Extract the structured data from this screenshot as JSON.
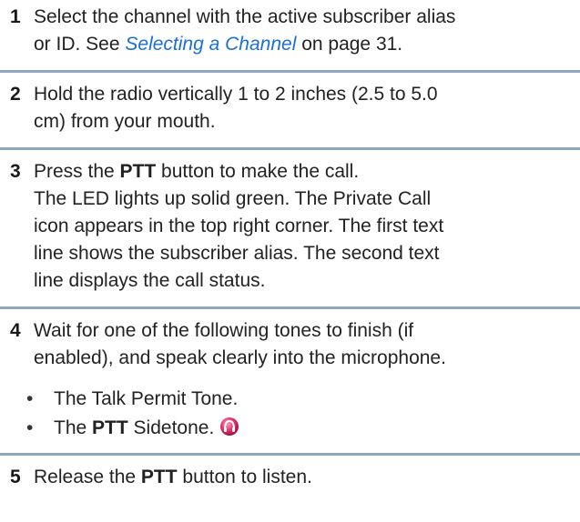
{
  "steps": [
    {
      "number": "1",
      "line1": "Select the channel with the active subscriber alias",
      "line2_before": "or ID. See ",
      "link": "Selecting a Channel",
      "line2_after": " on page 31."
    },
    {
      "number": "2",
      "line1": "Hold the radio vertically 1 to 2 inches (2.5 to 5.0",
      "line2": "cm) from your mouth."
    },
    {
      "number": "3",
      "line1_before": "Press the ",
      "line1_bold": "PTT",
      "line1_after": " button to make the call.",
      "line2": "The LED lights up solid green. The Private Call",
      "line3": "icon appears in the top right corner. The first text",
      "line4": "line shows the subscriber alias. The second text",
      "line5": "line displays the call status."
    },
    {
      "number": "4",
      "line1": "Wait for one of the following tones to finish (if",
      "line2": "enabled), and speak clearly into the microphone.",
      "bullets": [
        {
          "text": "The Talk Permit Tone."
        },
        {
          "before": "The ",
          "bold": "PTT",
          "after": " Sidetone."
        }
      ]
    },
    {
      "number": "5",
      "line1_before": "Release the ",
      "line1_bold": "PTT",
      "line1_after": " button to listen."
    }
  ],
  "icons": {
    "sidetone": "sidetone-icon"
  },
  "colors": {
    "link": "#1a6fd6",
    "separator": "#8ea7bf",
    "sidetone_icon": "#e0306a"
  }
}
